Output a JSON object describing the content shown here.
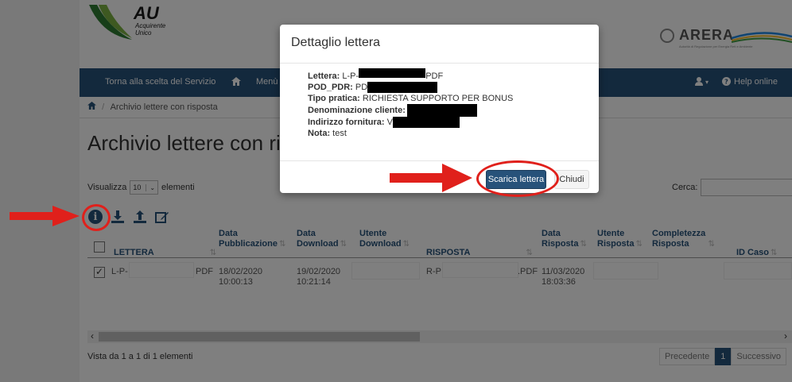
{
  "header": {
    "logo_au": "AU",
    "logo_au_sub": "Acquirente\nUnico",
    "logo_arera": "ARERA",
    "logo_arera_sub": "Autorità di Regolazione per Energia Reti e Ambiente"
  },
  "navbar": {
    "back": "Torna alla scelta del Servizio",
    "menu": "Menù",
    "user_caret": "▾",
    "help": "Help online"
  },
  "breadcrumb": {
    "current": "Archivio lettere con risposta"
  },
  "page_title": "Archivio lettere con ri",
  "length": {
    "prefix": "Visualizza",
    "value": "10",
    "suffix": "elementi"
  },
  "search": {
    "label": "Cerca:",
    "value": ""
  },
  "toolbar": {
    "icons": [
      "info-icon",
      "download-icon",
      "upload-icon",
      "edit-icon"
    ]
  },
  "table": {
    "headers": {
      "lettera": "LETTERA",
      "pubblicazione": [
        "Data",
        "Pubblicazione"
      ],
      "download": [
        "Data",
        "Download"
      ],
      "utente_download": [
        "Utente",
        "Download"
      ],
      "risposta": "RISPOSTA",
      "data_risposta": [
        "Data",
        "Risposta"
      ],
      "utente_risposta": [
        "Utente",
        "Risposta"
      ],
      "completezza": [
        "Completezza",
        "Risposta"
      ],
      "id_caso": "ID Caso"
    },
    "row": {
      "checked": true,
      "lettera_prefix": "L-P-",
      "lettera_suffix": "PDF",
      "pubblicazione": [
        "18/02/2020",
        "10:00:13"
      ],
      "download": [
        "19/02/2020",
        "10:21:14"
      ],
      "risposta_prefix": "R-P",
      "risposta_suffix": ".PDF",
      "data_risposta": [
        "11/03/2020",
        "18:03:36"
      ]
    }
  },
  "footer": {
    "info": "Vista da 1 a 1 di 1 elementi",
    "prev": "Precedente",
    "page": "1",
    "next": "Successivo"
  },
  "modal": {
    "title": "Dettaglio lettera",
    "lettera_label": "Lettera:",
    "lettera_prefix": "L-P-",
    "lettera_suffix": "PDF",
    "pod_label": "POD_PDR:",
    "pod_prefix": "PD",
    "tipo_label": "Tipo pratica:",
    "tipo_value": "RICHIESTA SUPPORTO PER BONUS",
    "denominazione_label": "Denominazione cliente:",
    "indirizzo_label": "Indirizzo fornitura:",
    "indirizzo_prefix": "V",
    "nota_label": "Nota:",
    "nota_value": "test",
    "download_button": "Scarica lettera",
    "close_button": "Chiudi"
  },
  "colors": {
    "primary": "#27527a",
    "annotation_red": "#e0201b"
  }
}
